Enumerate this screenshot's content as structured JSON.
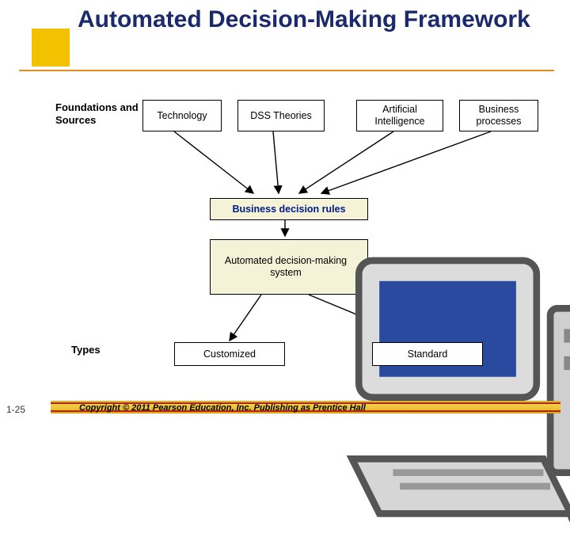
{
  "title": "Automated Decision-Making Framework",
  "labels": {
    "foundations": "Foundations and Sources",
    "types": "Types"
  },
  "source_boxes": [
    {
      "text": "Technology"
    },
    {
      "text": "DSS Theories"
    },
    {
      "text": "Artificial Intelligence"
    },
    {
      "text": "Business processes"
    }
  ],
  "middle": {
    "rules": "Business decision rules",
    "adm": "Automated decision-making system"
  },
  "types_boxes": [
    {
      "text": "Customized"
    },
    {
      "text": "Standard"
    }
  ],
  "footer": {
    "slide_number": "1-25",
    "copyright": "Copyright © 2011 Pearson Education, Inc. Publishing as Prentice Hall"
  },
  "colors": {
    "title_text": "#1a2a6c",
    "accent_square": "#f2c200",
    "title_rule": "#e58a1f",
    "box_border": "#000000",
    "cream_fill": "#f5f3d7",
    "blue_text": "#001a8a"
  }
}
